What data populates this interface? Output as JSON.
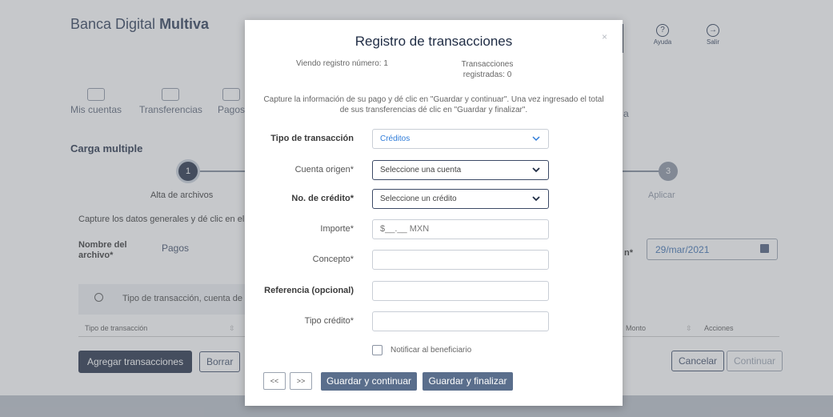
{
  "background": {
    "bank_name_regular": "Banca Digital ",
    "bank_name_bold": "Multiva",
    "top_icons": [
      {
        "label": "Ayuda",
        "icon": "help-icon",
        "glyph": "?"
      },
      {
        "label": "Salir",
        "icon": "logout-icon",
        "glyph": "→"
      }
    ],
    "nav": [
      {
        "label": "Mis cuentas",
        "icon": "accounts-icon"
      },
      {
        "label": "Transferencias",
        "icon": "transfers-icon"
      },
      {
        "label": "Pagos",
        "icon": "payments-icon"
      }
    ],
    "nav_partial_text": "a",
    "section_title": "Carga multiple",
    "steps": [
      {
        "number": "1",
        "label": "Alta de archivos",
        "active": true
      },
      {
        "number": "3",
        "label": "Aplicar",
        "active": false
      }
    ],
    "capture_text": "Capture los datos generales y dé clic en el bo",
    "file_name_label_1": "Nombre del",
    "file_name_label_2": "archivo*",
    "file_name_value": "Pagos",
    "date_label_partial": "n*",
    "date_value": "29/mar/2021",
    "search_text": "Tipo de transacción, cuenta de re",
    "table_headers": {
      "type": "Tipo de transacción",
      "amount": "Monto",
      "actions": "Acciones"
    },
    "buttons": {
      "add": "Agregar transacciones",
      "delete": "Borrar",
      "cancel": "Cancelar",
      "continue": "Continuar"
    }
  },
  "modal": {
    "title": "Registro de transacciones",
    "close": "×",
    "viewing_record": "Viendo registro número: 1",
    "registered_transactions": "Transacciones registradas: 0",
    "instructions": "Capture la información de su pago y dé clic en \"Guardar y continuar\". Una vez ingresado el total de sus transferencias dé clic en \"Guardar y finalizar\".",
    "fields": {
      "transaction_type": {
        "label": "Tipo de transacción",
        "value": "Créditos"
      },
      "source_account": {
        "label": "Cuenta origen*",
        "value": "Seleccione una cuenta"
      },
      "credit_number": {
        "label": "No. de crédito*",
        "value": "Seleccione un crédito"
      },
      "amount": {
        "label": "Importe*",
        "placeholder": "$__.__ MXN"
      },
      "concept": {
        "label": "Concepto*",
        "value": ""
      },
      "reference": {
        "label": "Referencia (opcional)",
        "value": ""
      },
      "credit_type": {
        "label": "Tipo crédito*",
        "value": ""
      }
    },
    "notify_label": "Notificar al beneficiario",
    "pager": {
      "prev": "<<",
      "next": ">>"
    },
    "buttons": {
      "save_continue": "Guardar y continuar",
      "save_finish": "Guardar y finalizar"
    }
  },
  "colors": {
    "brand_navy": "#1f2c44",
    "modal_button": "#5a6e8c",
    "select_blue": "#2f7cd9"
  }
}
